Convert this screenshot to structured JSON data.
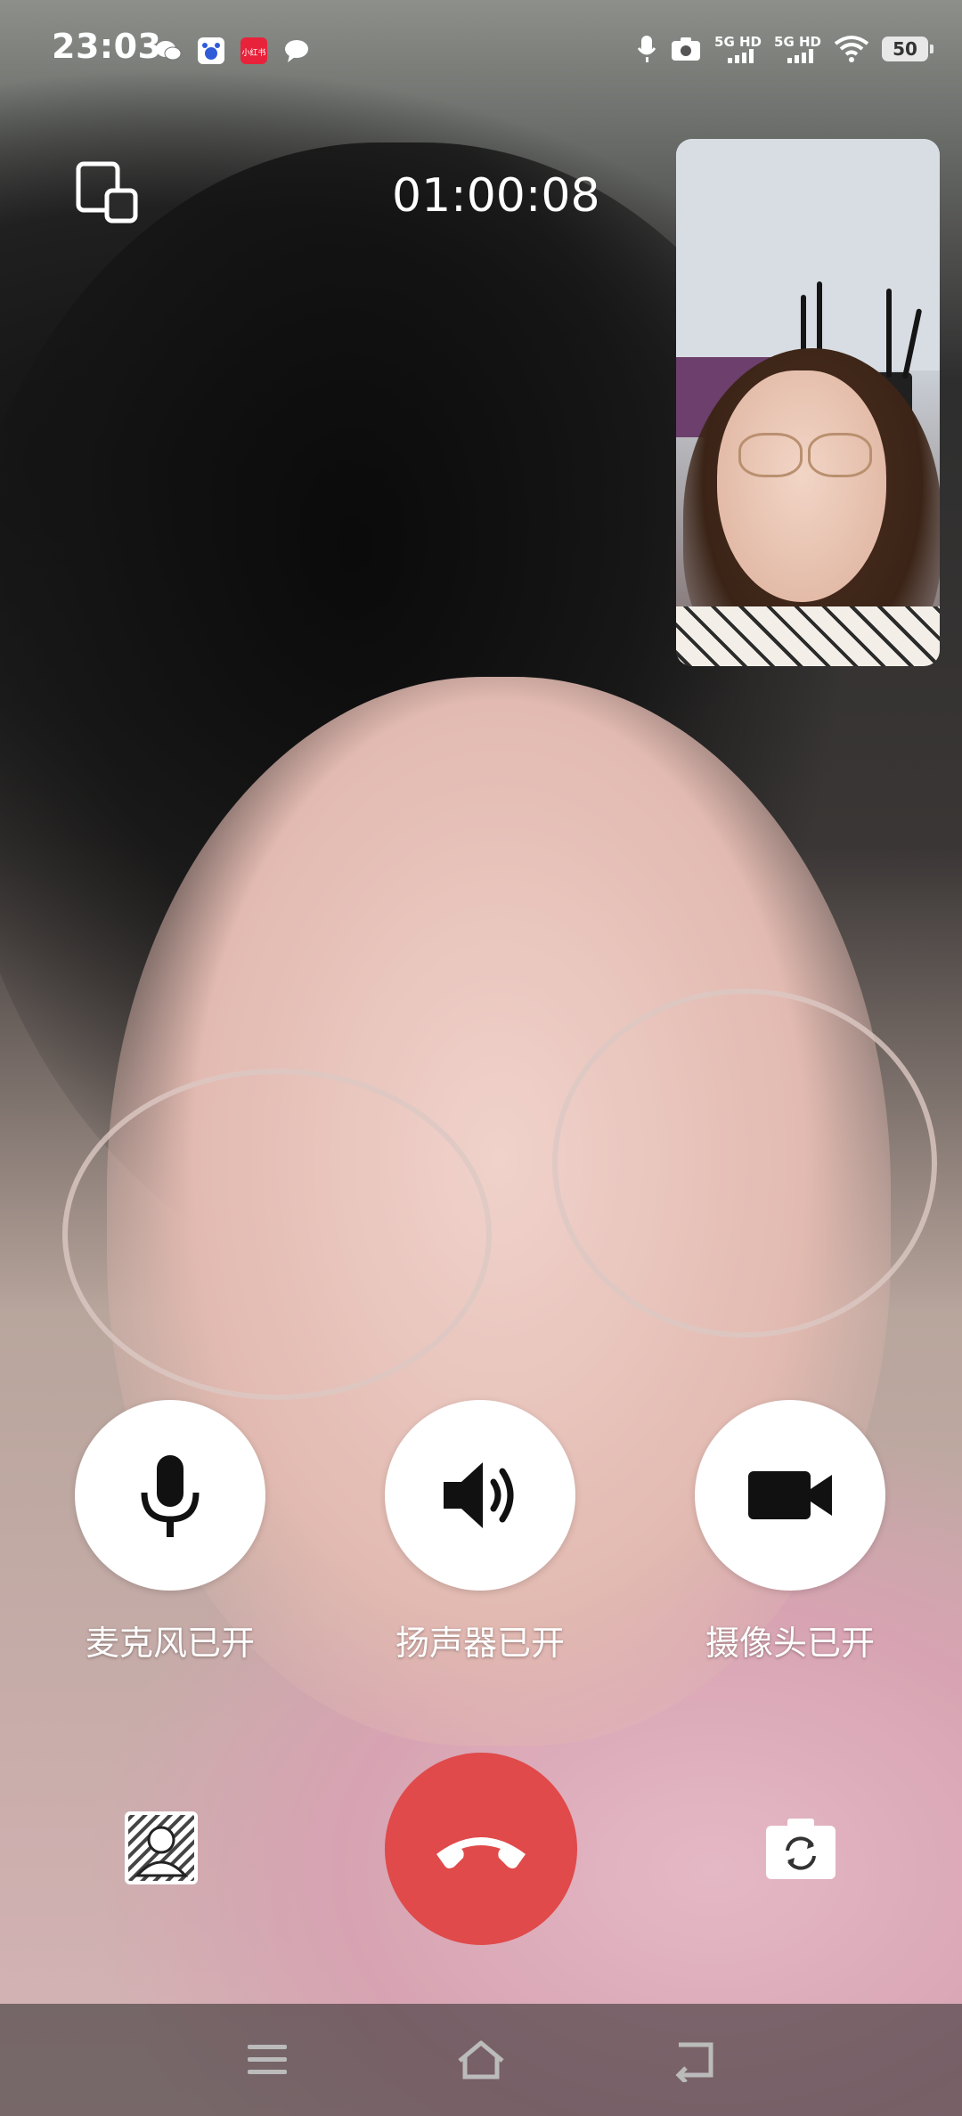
{
  "status_bar": {
    "time": "23:03",
    "notifications": [
      "wechat-icon",
      "baidu-icon",
      "xiaohongshu-icon",
      "message-icon"
    ],
    "xiaohongshu_badge": "小红书",
    "signal1_label": "5G HD",
    "signal2_label": "5G HD",
    "battery": "50"
  },
  "call": {
    "timer": "01:00:08"
  },
  "controls": {
    "mic_label": "麦克风已开",
    "speaker_label": "扬声器已开",
    "camera_label": "摄像头已开"
  },
  "colors": {
    "hangup": "#e04a4a",
    "button_bg": "#ffffff",
    "icon": "#111111"
  }
}
